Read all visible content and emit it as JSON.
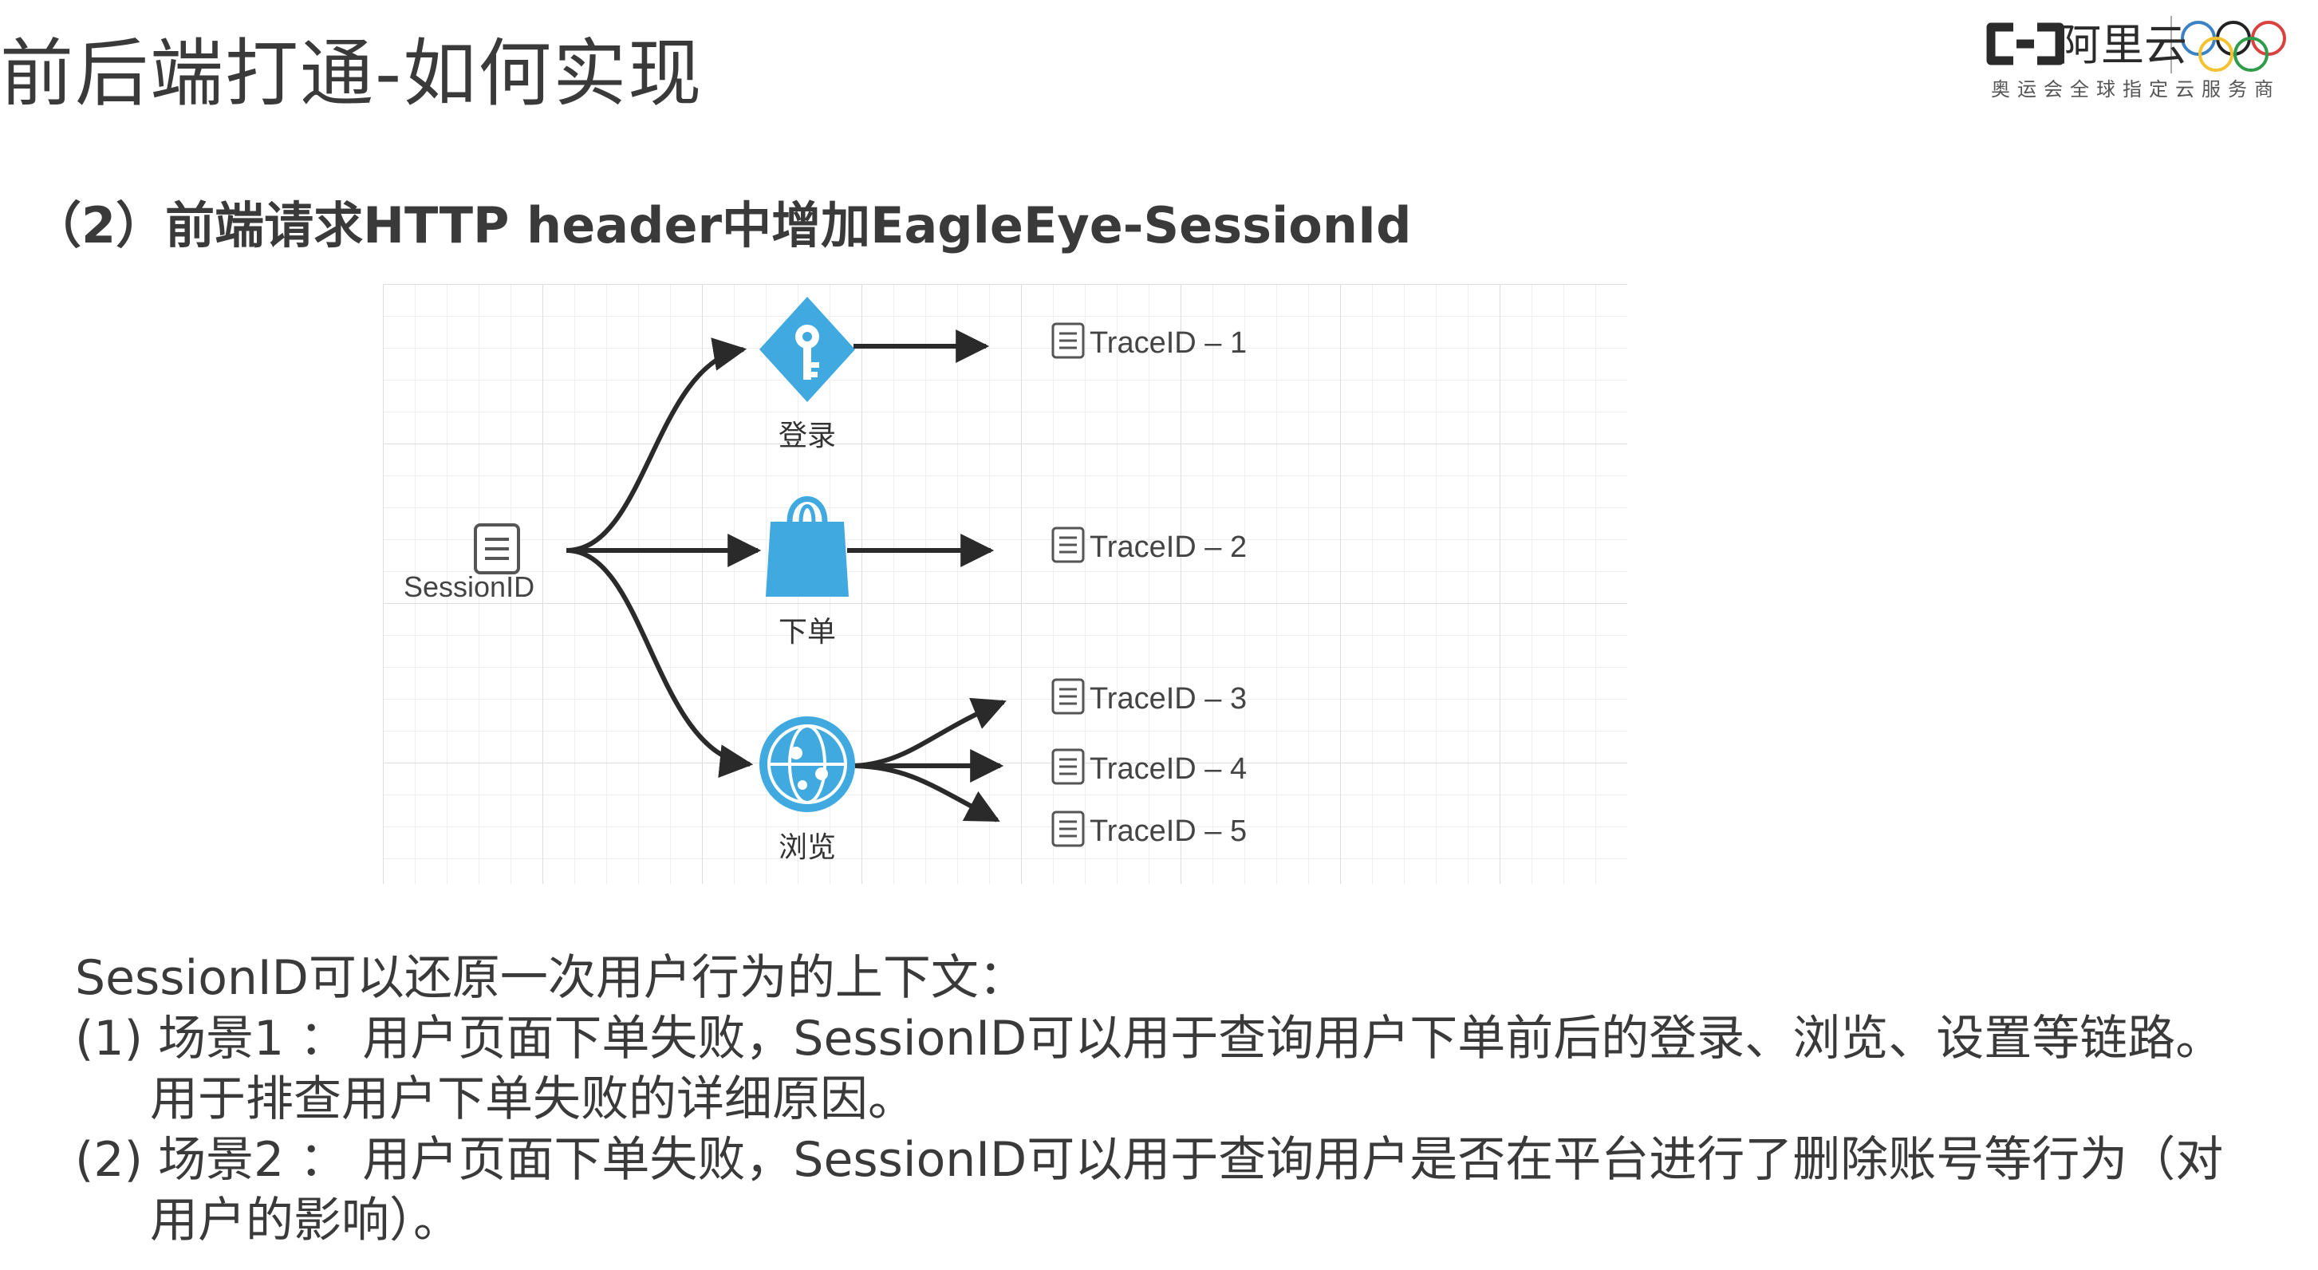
{
  "slide": {
    "title": "前后端打通-如何实现",
    "subtitle": "（2）前端请求HTTP header中增加EagleEye-SessionId"
  },
  "logo": {
    "brand": "阿里云",
    "tagline": "奥运会全球指定云服务商",
    "brand_color": "#2b2b2b",
    "rings_colors": [
      "#3b82c4",
      "#f2c230",
      "#222222",
      "#2e9c4a",
      "#d94040"
    ]
  },
  "diagram": {
    "source": {
      "label": "SessionID",
      "icon": "document-icon"
    },
    "actions": [
      {
        "label": "登录",
        "icon": "key-icon"
      },
      {
        "label": "下单",
        "icon": "shopping-bag-icon"
      },
      {
        "label": "浏览",
        "icon": "globe-icon"
      }
    ],
    "traces": [
      {
        "label": "TraceID – 1",
        "icon": "document-icon"
      },
      {
        "label": "TraceID – 2",
        "icon": "document-icon"
      },
      {
        "label": "TraceID – 3",
        "icon": "document-icon"
      },
      {
        "label": "TraceID – 4",
        "icon": "document-icon"
      },
      {
        "label": "TraceID – 5",
        "icon": "document-icon"
      }
    ],
    "accent_color": "#3fa9e0",
    "grid_color": "#e6e6e6"
  },
  "body": {
    "line1": "SessionID可以还原一次用户行为的上下文：",
    "line2": "(1) 场景1 ： 用户页面下单失败，SessionID可以用于查询用户下单前后的登录、浏览、设置等链路。",
    "line3": "用于排查用户下单失败的详细原因。",
    "line4": "(2) 场景2 ： 用户页面下单失败，SessionID可以用于查询用户是否在平台进行了删除账号等行为（对",
    "line5": "用户的影响）。"
  }
}
